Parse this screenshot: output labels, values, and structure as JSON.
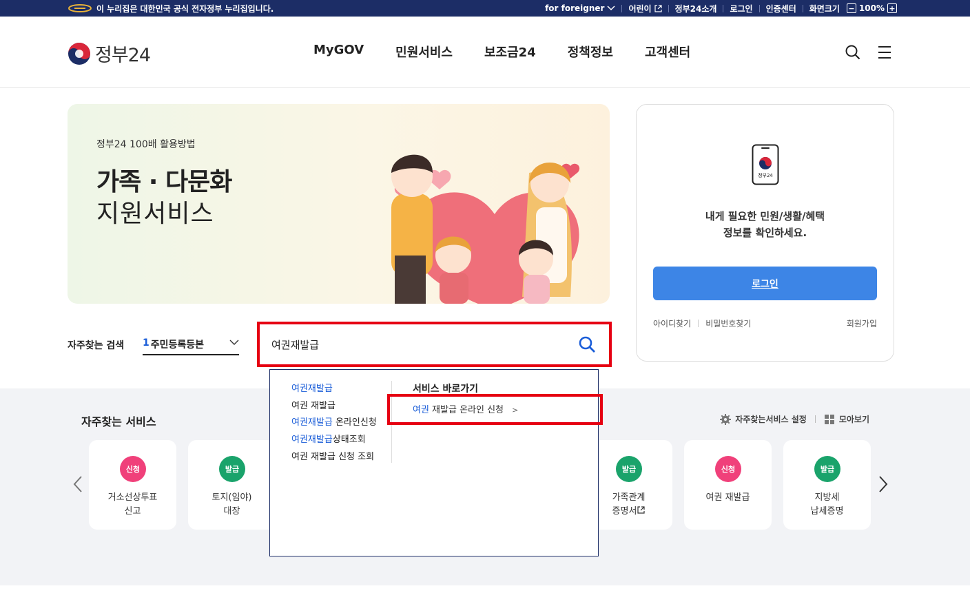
{
  "govbar": {
    "notice": "이 누리집은 대한민국 공식 전자정부 누리집입니다.",
    "foreigner": "for foreigner",
    "kids": "어린이",
    "intro": "정부24소개",
    "login": "로그인",
    "cert": "인증센터",
    "screen_size": "화면크기",
    "zoom": "100%"
  },
  "header": {
    "logo_text": "정부24",
    "nav": [
      "MyGOV",
      "민원서비스",
      "보조금24",
      "정책정보",
      "고객센터"
    ]
  },
  "banner": {
    "subtitle": "정부24 100배 활용방법",
    "title_line1": "가족 · 다문화",
    "title_line2": "지원서비스"
  },
  "login_box": {
    "phone_label": "정부24",
    "message_line1": "내게 필요한 민원/생활/혜택",
    "message_line2": "정보를 확인하세요.",
    "login_button": "로그인",
    "find_id": "아이디찾기",
    "find_pw": "비밀번호찾기",
    "join": "회원가입"
  },
  "frequent_search": {
    "label": "자주찾는 검색",
    "selected_rank": "1",
    "selected_text": "주민등록등본"
  },
  "search": {
    "value": "여권재발급"
  },
  "autocomplete": {
    "suggestions": [
      {
        "hl": "여권재발급",
        "rest": ""
      },
      {
        "hl": "",
        "rest": "여권 재발급"
      },
      {
        "hl": "여권재발급",
        "rest": " 온라인신청"
      },
      {
        "hl": "여권재발급",
        "rest": "상태조회"
      },
      {
        "hl": "",
        "rest": "여권 재발급 신청 조회"
      }
    ],
    "shortcut_title": "서비스 바로가기",
    "shortcut_hl": "여권",
    "shortcut_rest": " 재발급 온라인 신청",
    "shortcut_arrow": ">"
  },
  "services": {
    "title": "자주찾는 서비스",
    "settings": "자주찾는서비스 설정",
    "gather": "모아보기",
    "cards": [
      {
        "badge": "신청",
        "line1": "거소선상투표",
        "line2": "신고"
      },
      {
        "badge": "발급",
        "line1": "토지(임야)",
        "line2": "대장"
      },
      {
        "badge": "발급",
        "line1": "가족관계",
        "line2": "증명서"
      },
      {
        "badge": "신청",
        "line1": "여권 재발급",
        "line2": ""
      },
      {
        "badge": "발급",
        "line1": "지방세",
        "line2": "납세증명"
      }
    ]
  },
  "colors": {
    "gov_navy": "#1c2d66",
    "primary_blue": "#3d85e6",
    "badge_apply": "#f0407a",
    "badge_issue": "#1aa36b",
    "highlight_red": "#e60012",
    "keyword_blue": "#1a5dd8"
  },
  "icons": {
    "search": "search-icon",
    "menu": "hamburger-menu-icon",
    "settings": "gear-icon",
    "gather": "grid-icon",
    "prev": "chevron-left-icon",
    "next": "chevron-right-icon",
    "external": "external-link-icon"
  }
}
